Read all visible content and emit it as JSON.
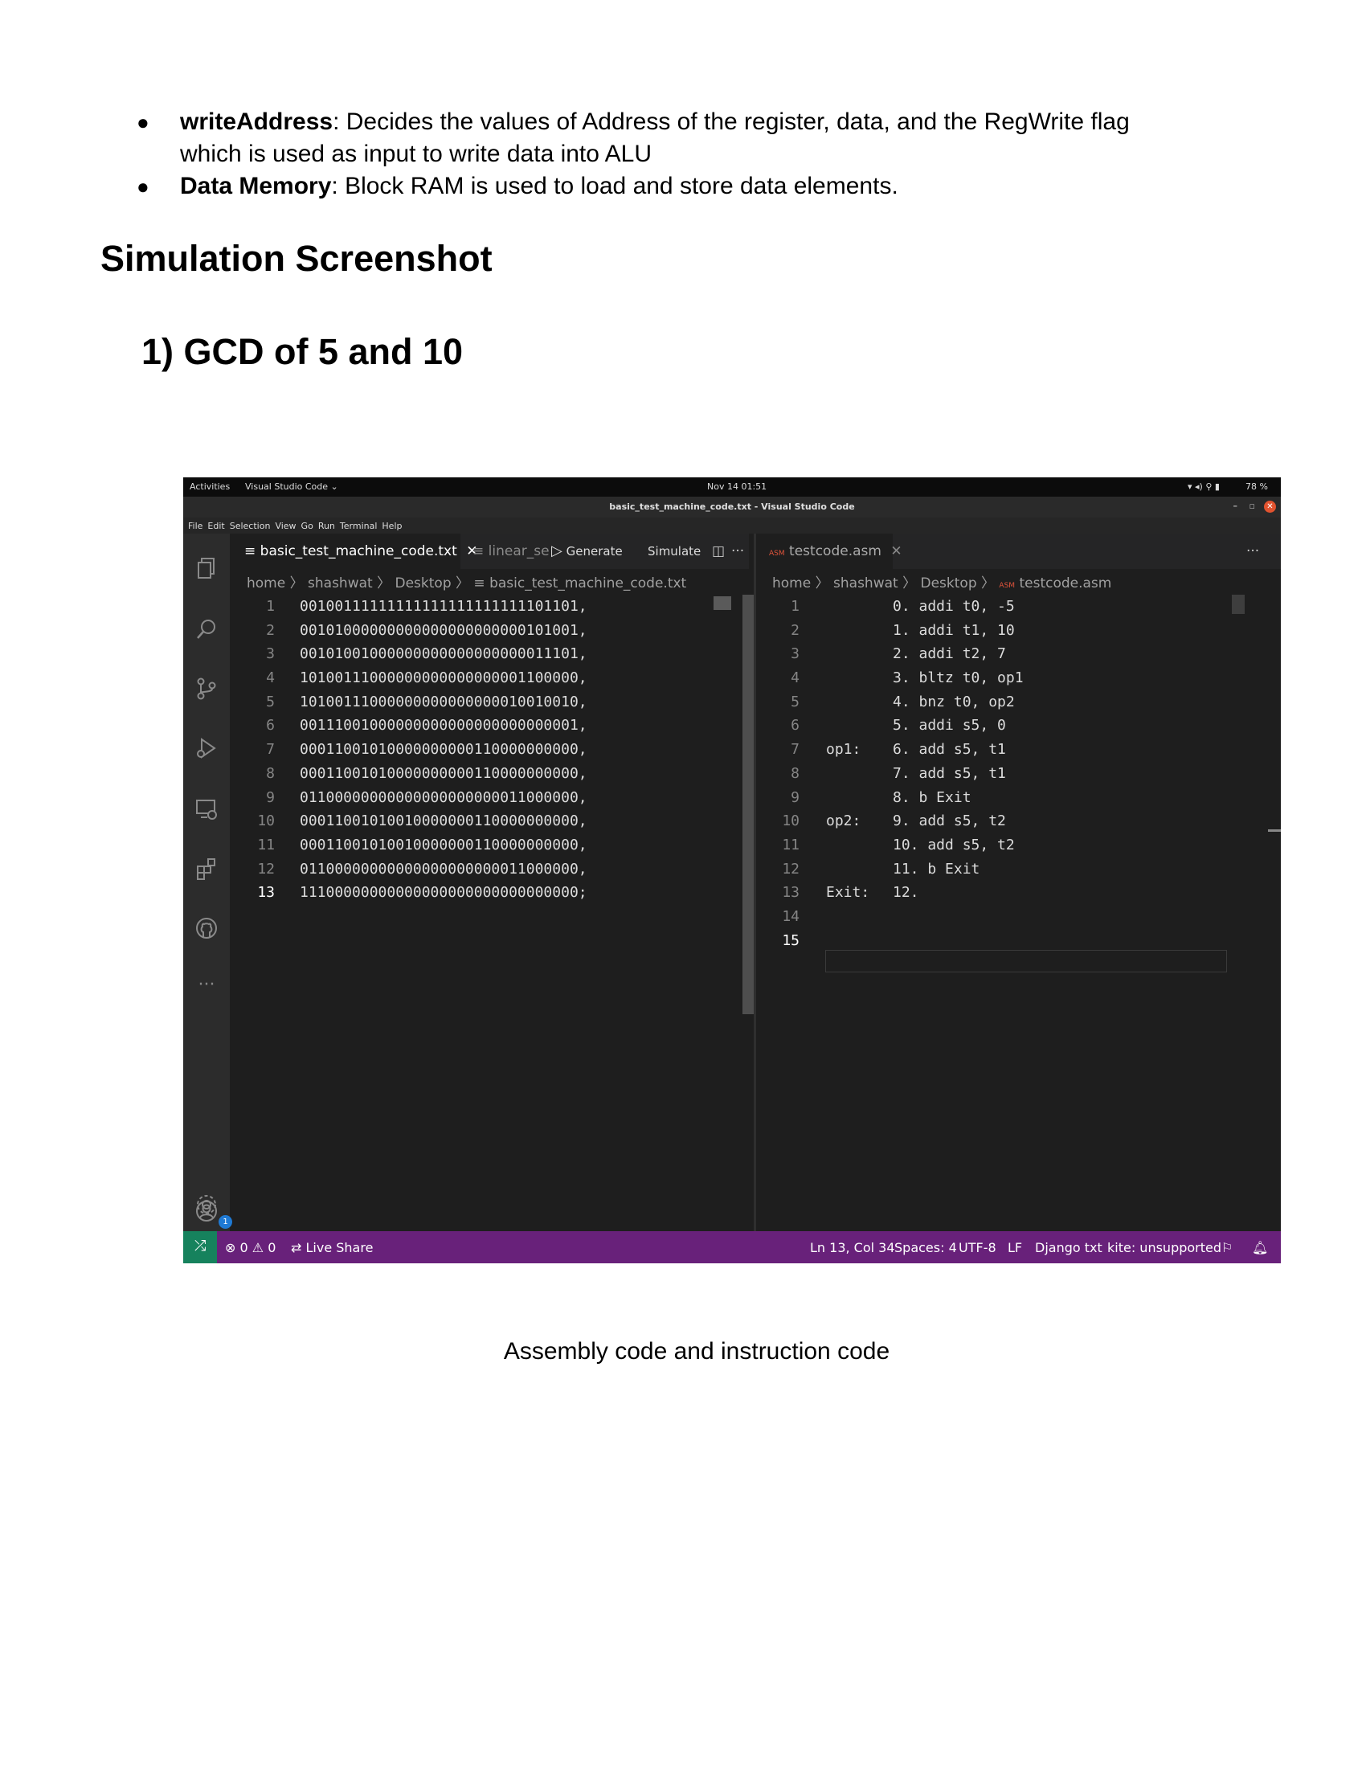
{
  "doc": {
    "bullets": [
      {
        "term": "writeAddress",
        "text": ": Decides the values of Address of the register, data, and the RegWrite flag which is used as input to write data into ALU"
      },
      {
        "term": "Data Memory",
        "text": ": Block RAM is used to load and store data elements."
      }
    ],
    "heading": "Simulation Screenshot",
    "subheading": "1) GCD of 5 and 10",
    "caption": "Assembly code and instruction code"
  },
  "screen": {
    "topbar": {
      "activities": "Activities",
      "app": "Visual Studio Code",
      "clock": "Nov 14  01:51",
      "battery": "78 %"
    },
    "window_title": "basic_test_machine_code.txt - Visual Studio Code",
    "menu": [
      "File",
      "Edit",
      "Selection",
      "View",
      "Go",
      "Run",
      "Terminal",
      "Help"
    ],
    "left_pane": {
      "active_tab": "basic_test_machine_code.txt",
      "second_tab": "linear_searc",
      "actions": {
        "generate": "Generate",
        "simulate": "Simulate"
      },
      "breadcrumb": [
        "home",
        "shashwat",
        "Desktop",
        "basic_test_machine_code.txt"
      ],
      "lines": [
        "00100111111111111111111111101101,",
        "00101000000000000000000000101001,",
        "00101001000000000000000000011101,",
        "10100111000000000000000001100000,",
        "10100111000000000000000010010010,",
        "00111001000000000000000000000001,",
        "00011001010000000000110000000000,",
        "00011001010000000000110000000000,",
        "01100000000000000000000011000000,",
        "00011001010010000000110000000000,",
        "00011001010010000000110000000000,",
        "01100000000000000000000011000000,",
        "11100000000000000000000000000000;"
      ]
    },
    "right_pane": {
      "tab": "testcode.asm",
      "breadcrumb": [
        "home",
        "shashwat",
        "Desktop",
        "testcode.asm"
      ],
      "labels": [
        "",
        "",
        "",
        "",
        "",
        "",
        "op1:",
        "",
        "",
        "op2:",
        "",
        "",
        "Exit:",
        "",
        ""
      ],
      "lines": [
        "0. addi t0, -5",
        "1. addi t1, 10",
        "2. addi t2, 7",
        "3. bltz t0, op1",
        "4. bnz t0, op2",
        "5. addi s5, 0",
        "6. add s5, t1",
        "7. add s5, t1",
        "8. b Exit",
        "9. add s5, t2",
        "10. add s5, t2",
        "11. b Exit",
        "12.",
        "",
        ""
      ]
    },
    "status": {
      "problems": "⊗ 0 ⚠ 0",
      "live_share": "Live Share",
      "position": "Ln 13, Col 34",
      "spaces": "Spaces: 4",
      "encoding": "UTF-8",
      "eol": "LF",
      "language": "Django txt",
      "kite": "kite: unsupported"
    },
    "accounts_badge": "1",
    "colors": {
      "statusbar": "#68217a",
      "editor_bg": "#1e1e1e",
      "activity_bg": "#2c2c2c"
    }
  }
}
